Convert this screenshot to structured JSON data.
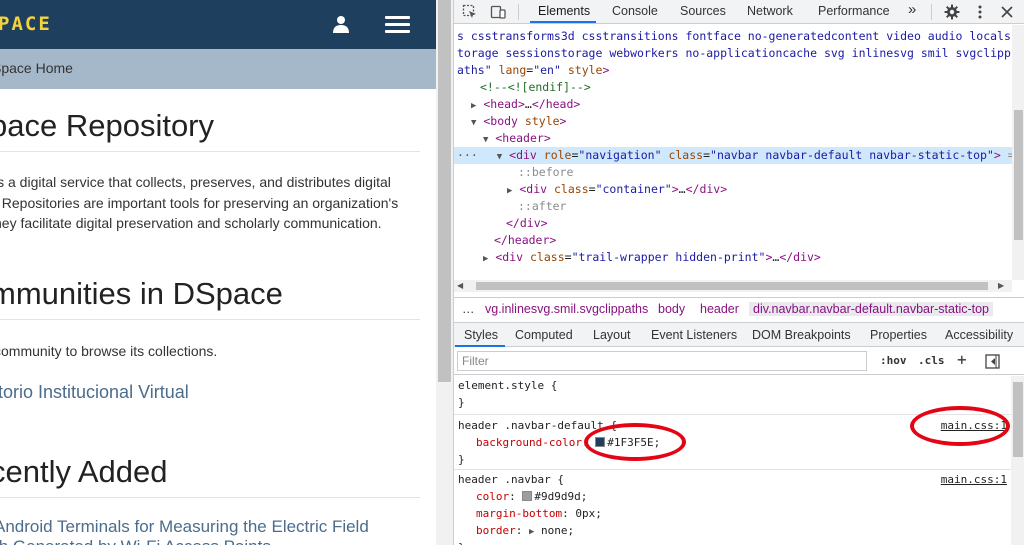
{
  "page": {
    "brand": "PACE",
    "breadcrumb": "Space Home",
    "main_heading": "pace Repository",
    "intro_lines": [
      "is a digital service that collects, preserves, and distributes digital",
      ". Repositories are important tools for preserving an organization's",
      "hey facilitate digital preservation and scholarly communication."
    ],
    "communities_heading": "mmunities in DSpace",
    "communities_help": "community to browse its collections.",
    "community_link": "itorio Institucional Virtual",
    "recent_heading": "cently Added",
    "recent_item_lines": [
      "Android Terminals for Measuring the Electric Field",
      "th Generated by Wi-Fi Access Points"
    ]
  },
  "devtools": {
    "tabs": [
      "Elements",
      "Console",
      "Sources",
      "Network",
      "Performance"
    ],
    "more_tabs": "»",
    "dom_lines": {
      "l0": "s csstransforms3d csstransitions fontface no-generatedcontent video audio locals",
      "l1": "torage sessionstorage webworkers no-applicationcache svg inlinesvg smil svgclipp",
      "l2_val": "aths\"",
      "l2_attr": "lang",
      "l2_attr_val": "\"en\"",
      "l2_style": "style",
      "comment": "<!--<![endif]-->",
      "head_open": "<head>",
      "ellipsis": "…",
      "head_close": "</head>",
      "body_open": "<body",
      "body_attr": "style",
      "header_open": "<header>",
      "div_open": "<div",
      "role_attr": "role",
      "role_val": "\"navigation\"",
      "class_attr": "class",
      "class_val": "\"navbar navbar-default navbar-static-top\"",
      "eq": "==",
      "before": "::before",
      "container_val": "\"container\"",
      "div_close": "</div>",
      "after": "::after",
      "header_close": "</header>",
      "trail_val": "\"trail-wrapper hidden-print\""
    },
    "breadcrumbs": [
      "…",
      "vg.inlinesvg.smil.svgclippaths",
      "body",
      "header",
      "div.navbar.navbar-default.navbar-static-top"
    ],
    "style_tabs": [
      "Styles",
      "Computed",
      "Layout",
      "Event Listeners",
      "DOM Breakpoints",
      "Properties",
      "Accessibility"
    ],
    "filter_placeholder": "Filter",
    "filter_tools": [
      ":hov",
      ".cls",
      "+"
    ],
    "rules": {
      "element_style": "element.style {",
      "close": "}",
      "r1_selector": "header .navbar-default {",
      "r1_prop": "background-color",
      "r1_value": "#1F3F5E",
      "r1_src": "main.css:1",
      "r2_selector": "header .navbar {",
      "r2_src": "main.css:1",
      "r2_p1": "color",
      "r2_v1": "#9d9d9d",
      "r2_p2": "margin-bottom",
      "r2_v2": "0px",
      "r2_p3": "border",
      "r2_v3": "none"
    }
  },
  "colors": {
    "navbar": "#1F3F5E",
    "brand": "#F3D23C",
    "trail": "#A5B8C9",
    "annotation": "#E40514",
    "swatch_grey": "#9d9d9d",
    "accent": "#1A73E8"
  }
}
